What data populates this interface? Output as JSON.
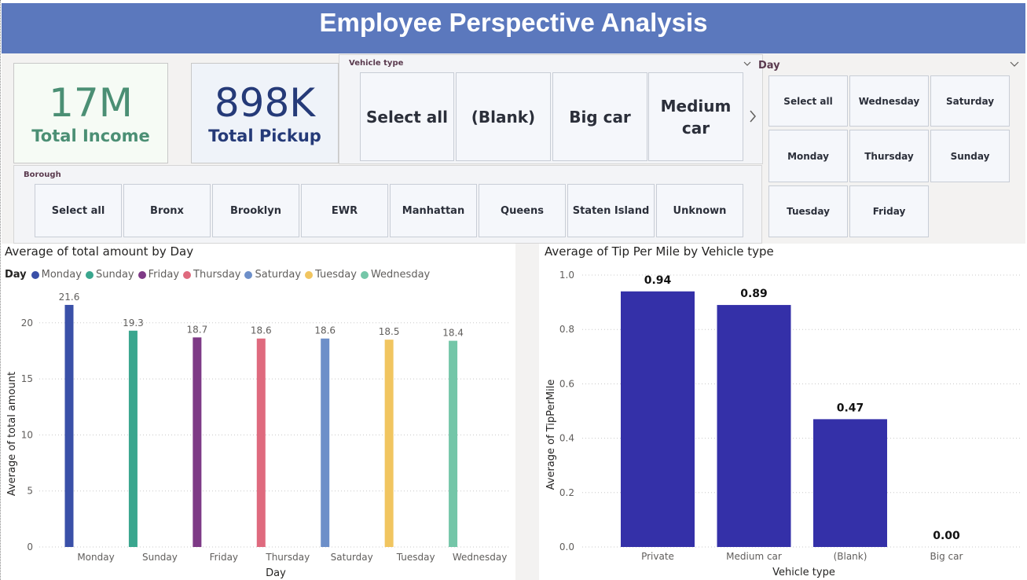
{
  "header": {
    "title": "Employee Perspective Analysis"
  },
  "kpis": {
    "income": {
      "value": "17M",
      "label": "Total Income"
    },
    "pickup": {
      "value": "898K",
      "label": "Total Pickup"
    }
  },
  "vehicle_slicer": {
    "title": "Vehicle type",
    "options": [
      "Select all",
      "(Blank)",
      "Big car",
      "Medium car"
    ]
  },
  "day_slicer": {
    "title": "Day",
    "options": [
      "Select all",
      "Wednesday",
      "Saturday",
      "Monday",
      "Thursday",
      "Sunday",
      "Tuesday",
      "Friday"
    ]
  },
  "borough_slicer": {
    "title": "Borough",
    "options": [
      "Select all",
      "Bronx",
      "Brooklyn",
      "EWR",
      "Manhattan",
      "Queens",
      "Staten Island",
      "Unknown"
    ]
  },
  "colors": {
    "header": "#5b78bd",
    "tip_bar": "#3430a8",
    "Monday": "#3a50a8",
    "Sunday": "#3aa68e",
    "Friday": "#7e3a86",
    "Thursday": "#df6a7e",
    "Saturday": "#6d8fc9",
    "Tuesday": "#f1c560",
    "Wednesday": "#74c6a8"
  },
  "chart_data": [
    {
      "type": "bar",
      "title": "Average of total amount by Day",
      "legend_title": "Day",
      "legend_placement": "top-left",
      "categories": [
        "Monday",
        "Sunday",
        "Friday",
        "Thursday",
        "Saturday",
        "Tuesday",
        "Wednesday"
      ],
      "values": [
        21.6,
        19.3,
        18.7,
        18.6,
        18.6,
        18.5,
        18.4
      ],
      "labels": [
        "21.6",
        "19.3",
        "18.7",
        "18.6",
        "18.6",
        "18.5",
        "18.4"
      ],
      "xlabel": "Day",
      "ylabel": "Average of total amount",
      "ylim": [
        0,
        23
      ],
      "yticks": [
        "0",
        "5",
        "10",
        "15",
        "20"
      ],
      "grid": true
    },
    {
      "type": "bar",
      "title": "Average of Tip Per Mile by Vehicle type",
      "categories": [
        "Private",
        "Medium car",
        "(Blank)",
        "Big car"
      ],
      "values": [
        0.94,
        0.89,
        0.47,
        0.0
      ],
      "labels": [
        "0.94",
        "0.89",
        "0.47",
        "0.00"
      ],
      "xlabel": "Vehicle type",
      "ylabel": "Average of TipPerMile",
      "ylim": [
        0,
        1.0
      ],
      "yticks": [
        "0.0",
        "0.2",
        "0.4",
        "0.6",
        "0.8",
        "1.0"
      ],
      "grid": true
    }
  ]
}
